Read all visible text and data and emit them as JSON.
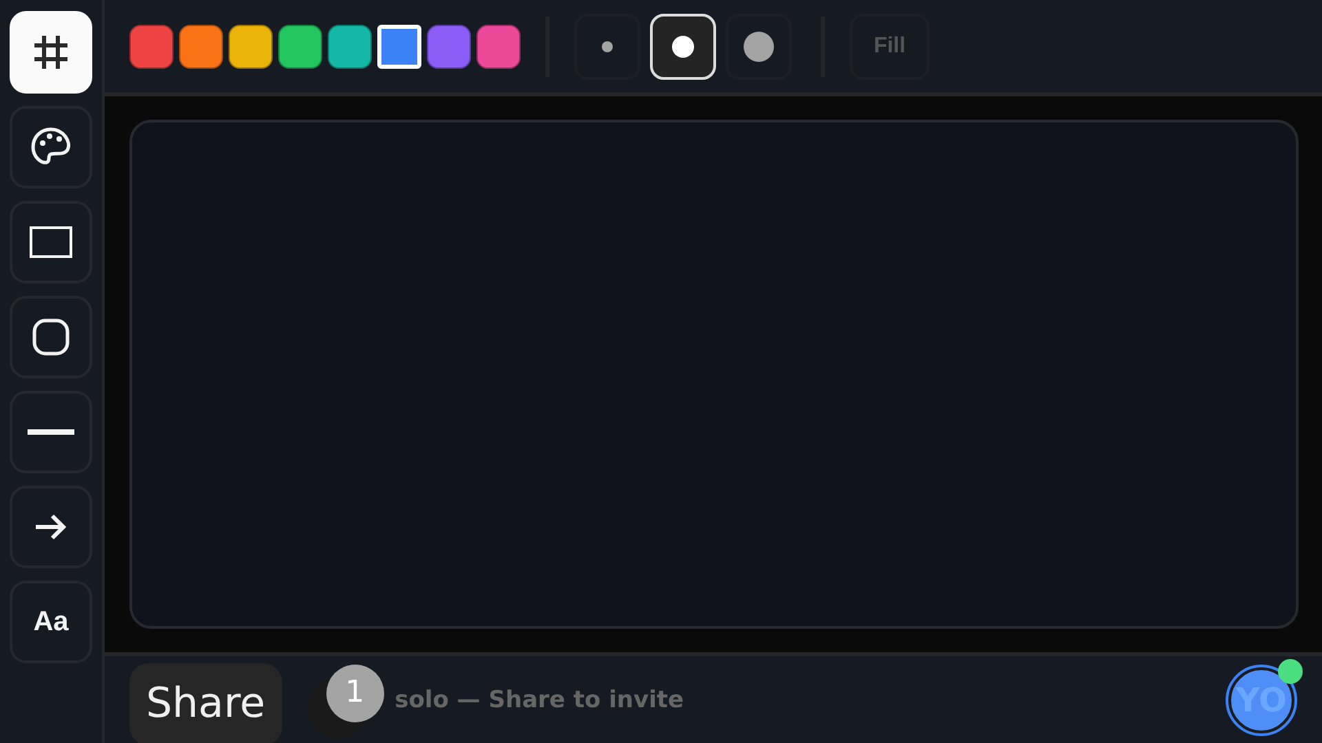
{
  "tools": [
    {
      "kind": "grid",
      "selected": true
    },
    {
      "kind": "palette",
      "selected": false
    },
    {
      "kind": "rect",
      "selected": false
    },
    {
      "kind": "ellipse",
      "selected": false
    },
    {
      "kind": "line",
      "selected": false
    },
    {
      "kind": "arrow",
      "selected": false
    },
    {
      "kind": "text",
      "label": "Aa",
      "selected": false
    }
  ],
  "colors": [
    {
      "color": "#ef4444",
      "selected": false
    },
    {
      "color": "#f97316",
      "selected": false
    },
    {
      "color": "#eab308",
      "selected": false
    },
    {
      "color": "#22c55e",
      "selected": false
    },
    {
      "color": "#14b8a6",
      "selected": false
    },
    {
      "color": "#3b82f6",
      "selected": true
    },
    {
      "color": "#8b5cf6",
      "selected": false
    },
    {
      "color": "#ec4899",
      "selected": false
    }
  ],
  "sizes": [
    {
      "kind": "small",
      "selected": false
    },
    {
      "kind": "medium",
      "selected": true
    },
    {
      "kind": "large",
      "selected": false
    }
  ],
  "fill": {
    "label": "Fill",
    "on": false
  },
  "footer": {
    "share": "Share",
    "count": "1",
    "status": "solo — Share to invite",
    "avatar": "YO",
    "online": true
  }
}
